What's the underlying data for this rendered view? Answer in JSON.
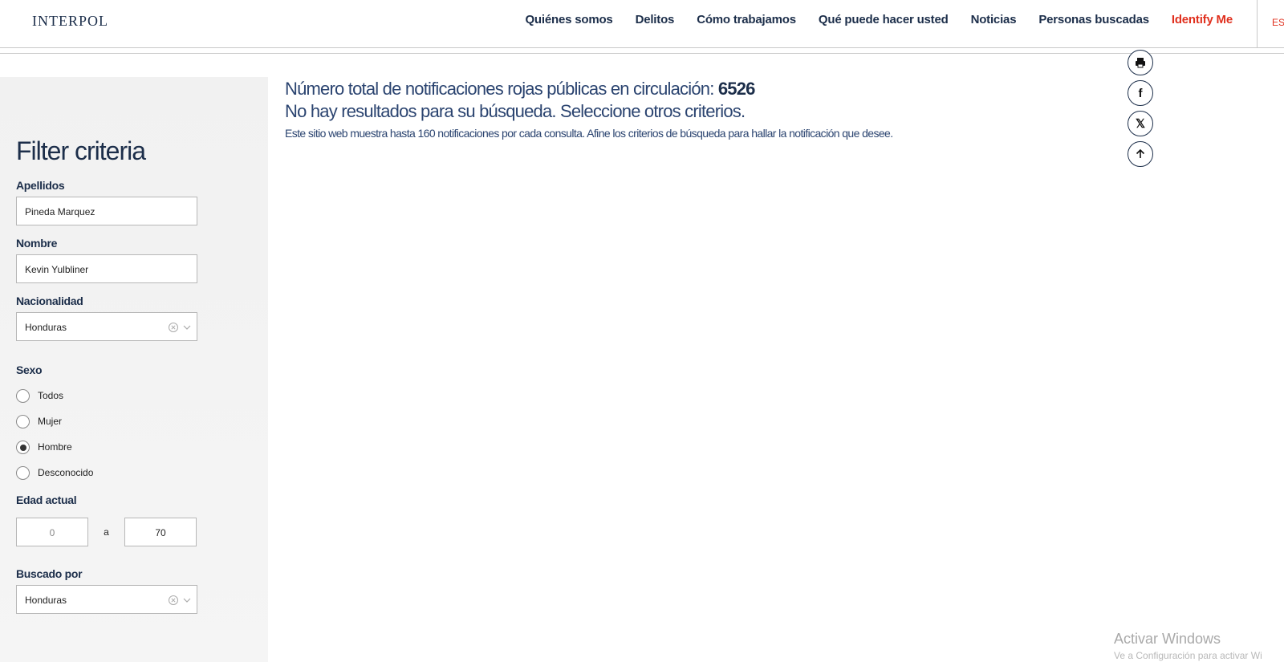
{
  "header": {
    "logo": "INTERPOL",
    "nav": [
      {
        "label": "Quiénes somos"
      },
      {
        "label": "Delitos"
      },
      {
        "label": "Cómo trabajamos"
      },
      {
        "label": "Qué puede hacer usted"
      },
      {
        "label": "Noticias"
      },
      {
        "label": "Personas buscadas"
      },
      {
        "label": "Identify Me"
      }
    ],
    "lang": "ES"
  },
  "sidebar": {
    "title": "Filter criteria",
    "apellidos": {
      "label": "Apellidos",
      "value": "Pineda Marquez"
    },
    "nombre": {
      "label": "Nombre",
      "value": "Kevin Yulbliner"
    },
    "nacionalidad": {
      "label": "Nacionalidad",
      "value": "Honduras"
    },
    "sexo": {
      "label": "Sexo",
      "options": [
        "Todos",
        "Mujer",
        "Hombre",
        "Desconocido"
      ],
      "selected": "Hombre"
    },
    "edad": {
      "label": "Edad actual",
      "min": "0",
      "sep": "a",
      "max": "70"
    },
    "buscado": {
      "label": "Buscado por",
      "value": "Honduras"
    }
  },
  "main": {
    "total_prefix": "Número total de notificaciones rojas públicas en circulación:",
    "total_value": "6526",
    "no_results": "No hay resultados para su búsqueda. Seleccione otros criterios.",
    "hint": "Este sitio web muestra hasta 160 notificaciones por cada consulta. Afine los criterios de búsqueda para hallar la notificación que desee."
  },
  "share": {
    "print_icon": "print-icon",
    "facebook_glyph": "f",
    "x_glyph": "𝕏",
    "top_icon": "arrow-up-icon"
  },
  "watermark": {
    "line1": "Activar Windows",
    "line2": "Ve a Configuración para activar Wi"
  }
}
